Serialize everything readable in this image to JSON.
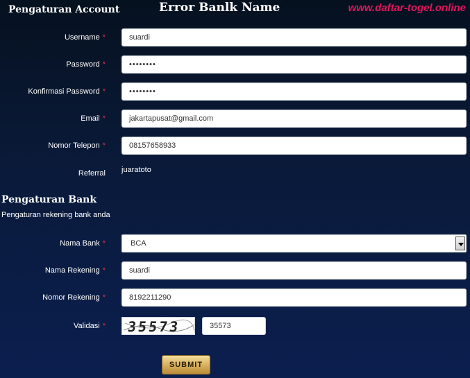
{
  "header": {
    "account_title": "Pengaturan Account",
    "error_title": "Error Banlk Name",
    "watermark": "www.daftar-togel.online"
  },
  "account": {
    "username": {
      "label": "Username",
      "value": "suardi"
    },
    "password": {
      "label": "Password",
      "value": "••••••••"
    },
    "confirm_password": {
      "label": "Konfirmasi Password",
      "value": "••••••••"
    },
    "email": {
      "label": "Email",
      "value": "jakartapusat@gmail.com"
    },
    "phone": {
      "label": "Nomor Telepon",
      "value": "08157658933"
    },
    "referral": {
      "label": "Referral",
      "value": "juaratoto"
    }
  },
  "required_mark": "*",
  "bank": {
    "title": "Pengaturan Bank",
    "subtitle": "Pengaturan rekening bank anda",
    "bank_name": {
      "label": "Nama Bank",
      "selected": "BCA"
    },
    "account_name": {
      "label": "Nama Rekening",
      "value": "suardi"
    },
    "account_number": {
      "label": "Nomor Rekening",
      "value": "8192211290"
    },
    "validation": {
      "label": "Validasi",
      "captcha": "35573",
      "value": "35573"
    }
  },
  "submit_label": "SUBMIT",
  "colors": {
    "required": "#e0304a",
    "watermark": "#e0145a",
    "submit_gold": "#d9b260"
  }
}
